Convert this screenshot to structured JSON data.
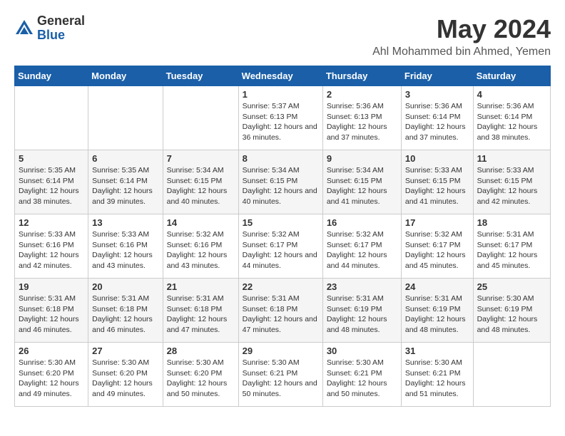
{
  "header": {
    "logo_general": "General",
    "logo_blue": "Blue",
    "month": "May 2024",
    "location": "Ahl Mohammed bin Ahmed, Yemen"
  },
  "weekdays": [
    "Sunday",
    "Monday",
    "Tuesday",
    "Wednesday",
    "Thursday",
    "Friday",
    "Saturday"
  ],
  "weeks": [
    [
      {
        "day": "",
        "sunrise": "",
        "sunset": "",
        "daylight": ""
      },
      {
        "day": "",
        "sunrise": "",
        "sunset": "",
        "daylight": ""
      },
      {
        "day": "",
        "sunrise": "",
        "sunset": "",
        "daylight": ""
      },
      {
        "day": "1",
        "sunrise": "Sunrise: 5:37 AM",
        "sunset": "Sunset: 6:13 PM",
        "daylight": "Daylight: 12 hours and 36 minutes."
      },
      {
        "day": "2",
        "sunrise": "Sunrise: 5:36 AM",
        "sunset": "Sunset: 6:13 PM",
        "daylight": "Daylight: 12 hours and 37 minutes."
      },
      {
        "day": "3",
        "sunrise": "Sunrise: 5:36 AM",
        "sunset": "Sunset: 6:14 PM",
        "daylight": "Daylight: 12 hours and 37 minutes."
      },
      {
        "day": "4",
        "sunrise": "Sunrise: 5:36 AM",
        "sunset": "Sunset: 6:14 PM",
        "daylight": "Daylight: 12 hours and 38 minutes."
      }
    ],
    [
      {
        "day": "5",
        "sunrise": "Sunrise: 5:35 AM",
        "sunset": "Sunset: 6:14 PM",
        "daylight": "Daylight: 12 hours and 38 minutes."
      },
      {
        "day": "6",
        "sunrise": "Sunrise: 5:35 AM",
        "sunset": "Sunset: 6:14 PM",
        "daylight": "Daylight: 12 hours and 39 minutes."
      },
      {
        "day": "7",
        "sunrise": "Sunrise: 5:34 AM",
        "sunset": "Sunset: 6:15 PM",
        "daylight": "Daylight: 12 hours and 40 minutes."
      },
      {
        "day": "8",
        "sunrise": "Sunrise: 5:34 AM",
        "sunset": "Sunset: 6:15 PM",
        "daylight": "Daylight: 12 hours and 40 minutes."
      },
      {
        "day": "9",
        "sunrise": "Sunrise: 5:34 AM",
        "sunset": "Sunset: 6:15 PM",
        "daylight": "Daylight: 12 hours and 41 minutes."
      },
      {
        "day": "10",
        "sunrise": "Sunrise: 5:33 AM",
        "sunset": "Sunset: 6:15 PM",
        "daylight": "Daylight: 12 hours and 41 minutes."
      },
      {
        "day": "11",
        "sunrise": "Sunrise: 5:33 AM",
        "sunset": "Sunset: 6:15 PM",
        "daylight": "Daylight: 12 hours and 42 minutes."
      }
    ],
    [
      {
        "day": "12",
        "sunrise": "Sunrise: 5:33 AM",
        "sunset": "Sunset: 6:16 PM",
        "daylight": "Daylight: 12 hours and 42 minutes."
      },
      {
        "day": "13",
        "sunrise": "Sunrise: 5:33 AM",
        "sunset": "Sunset: 6:16 PM",
        "daylight": "Daylight: 12 hours and 43 minutes."
      },
      {
        "day": "14",
        "sunrise": "Sunrise: 5:32 AM",
        "sunset": "Sunset: 6:16 PM",
        "daylight": "Daylight: 12 hours and 43 minutes."
      },
      {
        "day": "15",
        "sunrise": "Sunrise: 5:32 AM",
        "sunset": "Sunset: 6:17 PM",
        "daylight": "Daylight: 12 hours and 44 minutes."
      },
      {
        "day": "16",
        "sunrise": "Sunrise: 5:32 AM",
        "sunset": "Sunset: 6:17 PM",
        "daylight": "Daylight: 12 hours and 44 minutes."
      },
      {
        "day": "17",
        "sunrise": "Sunrise: 5:32 AM",
        "sunset": "Sunset: 6:17 PM",
        "daylight": "Daylight: 12 hours and 45 minutes."
      },
      {
        "day": "18",
        "sunrise": "Sunrise: 5:31 AM",
        "sunset": "Sunset: 6:17 PM",
        "daylight": "Daylight: 12 hours and 45 minutes."
      }
    ],
    [
      {
        "day": "19",
        "sunrise": "Sunrise: 5:31 AM",
        "sunset": "Sunset: 6:18 PM",
        "daylight": "Daylight: 12 hours and 46 minutes."
      },
      {
        "day": "20",
        "sunrise": "Sunrise: 5:31 AM",
        "sunset": "Sunset: 6:18 PM",
        "daylight": "Daylight: 12 hours and 46 minutes."
      },
      {
        "day": "21",
        "sunrise": "Sunrise: 5:31 AM",
        "sunset": "Sunset: 6:18 PM",
        "daylight": "Daylight: 12 hours and 47 minutes."
      },
      {
        "day": "22",
        "sunrise": "Sunrise: 5:31 AM",
        "sunset": "Sunset: 6:18 PM",
        "daylight": "Daylight: 12 hours and 47 minutes."
      },
      {
        "day": "23",
        "sunrise": "Sunrise: 5:31 AM",
        "sunset": "Sunset: 6:19 PM",
        "daylight": "Daylight: 12 hours and 48 minutes."
      },
      {
        "day": "24",
        "sunrise": "Sunrise: 5:31 AM",
        "sunset": "Sunset: 6:19 PM",
        "daylight": "Daylight: 12 hours and 48 minutes."
      },
      {
        "day": "25",
        "sunrise": "Sunrise: 5:30 AM",
        "sunset": "Sunset: 6:19 PM",
        "daylight": "Daylight: 12 hours and 48 minutes."
      }
    ],
    [
      {
        "day": "26",
        "sunrise": "Sunrise: 5:30 AM",
        "sunset": "Sunset: 6:20 PM",
        "daylight": "Daylight: 12 hours and 49 minutes."
      },
      {
        "day": "27",
        "sunrise": "Sunrise: 5:30 AM",
        "sunset": "Sunset: 6:20 PM",
        "daylight": "Daylight: 12 hours and 49 minutes."
      },
      {
        "day": "28",
        "sunrise": "Sunrise: 5:30 AM",
        "sunset": "Sunset: 6:20 PM",
        "daylight": "Daylight: 12 hours and 50 minutes."
      },
      {
        "day": "29",
        "sunrise": "Sunrise: 5:30 AM",
        "sunset": "Sunset: 6:21 PM",
        "daylight": "Daylight: 12 hours and 50 minutes."
      },
      {
        "day": "30",
        "sunrise": "Sunrise: 5:30 AM",
        "sunset": "Sunset: 6:21 PM",
        "daylight": "Daylight: 12 hours and 50 minutes."
      },
      {
        "day": "31",
        "sunrise": "Sunrise: 5:30 AM",
        "sunset": "Sunset: 6:21 PM",
        "daylight": "Daylight: 12 hours and 51 minutes."
      },
      {
        "day": "",
        "sunrise": "",
        "sunset": "",
        "daylight": ""
      }
    ]
  ]
}
